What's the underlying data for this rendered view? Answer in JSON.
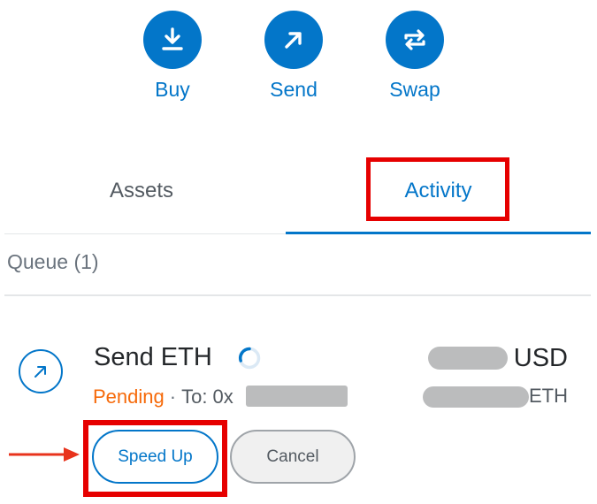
{
  "actions": {
    "buy_label": "Buy",
    "send_label": "Send",
    "swap_label": "Swap"
  },
  "tabs": {
    "assets_label": "Assets",
    "activity_label": "Activity",
    "selected": "Activity"
  },
  "queue": {
    "label": "Queue (1)"
  },
  "transaction": {
    "title": "Send ETH",
    "status": "Pending",
    "separator": "·",
    "to_prefix": "To: 0x",
    "usd_suffix": "USD",
    "eth_suffix": "ETH",
    "speed_up_label": "Speed Up",
    "cancel_label": "Cancel"
  },
  "colors": {
    "primary": "#0376c9",
    "pending": "#f66a0a",
    "highlight": "#e60000",
    "text": "#24272a",
    "muted": "#6a737d"
  },
  "icons": {
    "buy": "download-icon",
    "send": "arrow-up-right-icon",
    "swap": "swap-icon",
    "transaction": "arrow-up-right-icon",
    "status": "spinner-icon"
  }
}
